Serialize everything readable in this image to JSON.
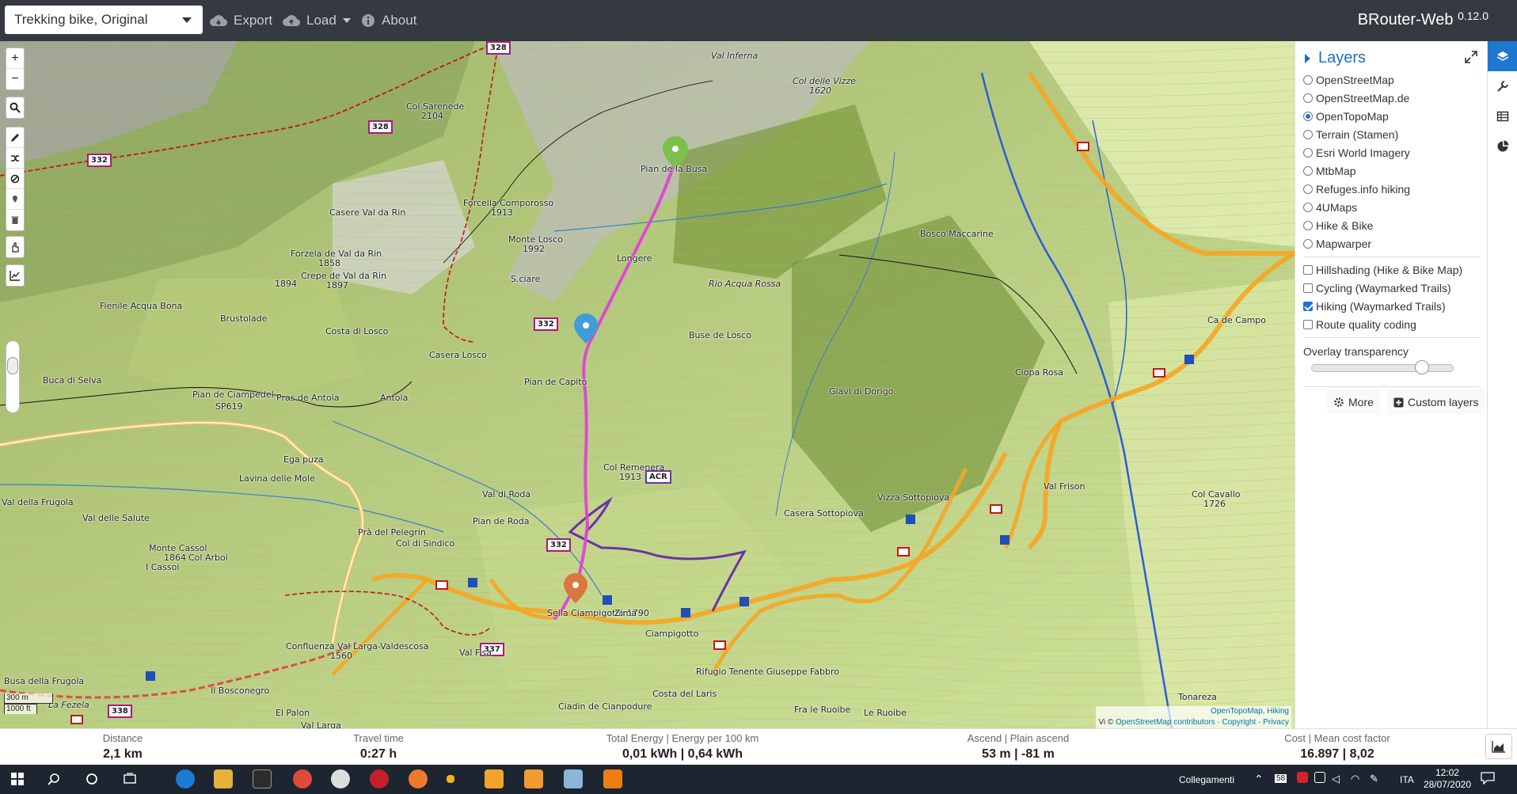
{
  "navbar": {
    "profile": "Trekking bike, Original",
    "export_label": "Export",
    "load_label": "Load",
    "about_label": "About",
    "brand": "BRouter-Web",
    "version": "0.12.0"
  },
  "map": {
    "labels": [
      {
        "text": "Val Inferna",
        "it": true
      },
      {
        "text": "Col delle Vizze",
        "it": true
      },
      {
        "text": "1620",
        "it": true
      },
      {
        "text": "Col Sarenede",
        "it": false
      },
      {
        "text": "2104",
        "it": false
      },
      {
        "text": "Pian de la Busa",
        "it": false
      },
      {
        "text": "Forcella Comporosso",
        "it": false
      },
      {
        "text": "1913",
        "it": false
      },
      {
        "text": "Casere Val da Rin",
        "it": false
      },
      {
        "text": "Monte Losco",
        "it": false
      },
      {
        "text": "1992",
        "it": false
      },
      {
        "text": "Forzela de Val da Rin",
        "it": false
      },
      {
        "text": "1858",
        "it": false
      },
      {
        "text": "Crepe de Val da Rin",
        "it": false
      },
      {
        "text": "1897",
        "it": false
      },
      {
        "text": "1894",
        "it": false
      },
      {
        "text": "Longere",
        "it": false
      },
      {
        "text": "Bosco Maccarine",
        "it": false
      },
      {
        "text": "S.ciare",
        "it": false
      },
      {
        "text": "Fienile Acqua Bona",
        "it": false
      },
      {
        "text": "Brustolade",
        "it": false
      },
      {
        "text": "Costa di Losco",
        "it": false
      },
      {
        "text": "Casera Losco",
        "it": false
      },
      {
        "text": "Buse de Losco",
        "it": false
      },
      {
        "text": "Rio Acqua Rossa",
        "it": true
      },
      {
        "text": "Buca di Selva",
        "it": false
      },
      {
        "text": "Pian de Ciampedel",
        "it": false
      },
      {
        "text": "Pras de Antoia",
        "it": false
      },
      {
        "text": "Antoia",
        "it": false
      },
      {
        "text": "Pian de Capito",
        "it": false
      },
      {
        "text": "Giavi di Dorigo",
        "it": false
      },
      {
        "text": "Ciopa Rosa",
        "it": false
      },
      {
        "text": "Ca de Campo",
        "it": false
      },
      {
        "text": "SP619",
        "it": false
      },
      {
        "text": "Ega puza",
        "it": false
      },
      {
        "text": "Col Remenera",
        "it": false
      },
      {
        "text": "1913",
        "it": false
      },
      {
        "text": "ACR",
        "it": false
      },
      {
        "text": "Lavina delle Mole",
        "it": false
      },
      {
        "text": "Val di Roda",
        "it": false
      },
      {
        "text": "Vizza Sottopiova",
        "it": false
      },
      {
        "text": "Val Frison",
        "it": false
      },
      {
        "text": "Col Cavallo",
        "it": false
      },
      {
        "text": "1726",
        "it": false
      },
      {
        "text": "Val della Frugola",
        "it": false
      },
      {
        "text": "Val delle Salute",
        "it": false
      },
      {
        "text": "Pian de Roda",
        "it": false
      },
      {
        "text": "Prà del Pelegrin",
        "it": false
      },
      {
        "text": "Col di Sindico",
        "it": false
      },
      {
        "text": "Casera Sottopiova",
        "it": false
      },
      {
        "text": "Sella Ciampigotto 1790",
        "it": false
      },
      {
        "text": "Zima",
        "it": false
      },
      {
        "text": "Monte Cassol",
        "it": false
      },
      {
        "text": "1864",
        "it": false
      },
      {
        "text": "Col Arboi",
        "it": false
      },
      {
        "text": "I Cassoi",
        "it": false
      },
      {
        "text": "Confluenza Val Larga-Valdescosa",
        "it": false
      },
      {
        "text": "1560",
        "it": false
      },
      {
        "text": "Ciampigotto",
        "it": false
      },
      {
        "text": "Rifugio Tenente Giuseppe Fabbro",
        "it": false
      },
      {
        "text": "Busa della Frugola",
        "it": false
      },
      {
        "text": "Il Bosconegro",
        "it": false
      },
      {
        "text": "Costa del Laris",
        "it": false
      },
      {
        "text": "El Palon",
        "it": false
      },
      {
        "text": "Ciadin de Cianpodure",
        "it": false
      },
      {
        "text": "Fra le Ruoibe",
        "it": false
      },
      {
        "text": "Le Ruoibe",
        "it": false
      },
      {
        "text": "Tonareza",
        "it": false
      },
      {
        "text": "Val Larga",
        "it": false
      },
      {
        "text": "La Fezela",
        "it": false
      },
      {
        "text": "Val Fisa",
        "it": false
      }
    ],
    "badges": [
      "332",
      "328",
      "328",
      "332",
      "332",
      "337",
      "338"
    ],
    "scale": {
      "metric": "300 m",
      "imperial": "1000 ft"
    },
    "attribution": {
      "line1": "OpenTopoMap, Hiking",
      "prefix": "© ",
      "osm": "OpenStreetMap contributors",
      "copyright": "Copyright",
      "privacy": "Privacy",
      "leaflet": "Vi"
    }
  },
  "controls": [
    "+",
    "−"
  ],
  "sidebar": {
    "title": "Layers",
    "base_layers": [
      {
        "label": "OpenStreetMap",
        "selected": false
      },
      {
        "label": "OpenStreetMap.de",
        "selected": false
      },
      {
        "label": "OpenTopoMap",
        "selected": true
      },
      {
        "label": "Terrain (Stamen)",
        "selected": false
      },
      {
        "label": "Esri World Imagery",
        "selected": false
      },
      {
        "label": "MtbMap",
        "selected": false
      },
      {
        "label": "Refuges.info hiking",
        "selected": false
      },
      {
        "label": "4UMaps",
        "selected": false
      },
      {
        "label": "Hike & Bike",
        "selected": false
      },
      {
        "label": "Mapwarper",
        "selected": false
      }
    ],
    "overlays": [
      {
        "label": "Hillshading (Hike & Bike Map)",
        "checked": false
      },
      {
        "label": "Cycling (Waymarked Trails)",
        "checked": false
      },
      {
        "label": "Hiking (Waymarked Trails)",
        "checked": true
      },
      {
        "label": "Route quality coding",
        "checked": false
      }
    ],
    "transparency_label": "Overlay transparency",
    "more_label": "More",
    "custom_label": "Custom layers"
  },
  "stats": [
    {
      "label": "Distance",
      "value": "2,1 km"
    },
    {
      "label": "Travel time",
      "value": "0:27 h"
    },
    {
      "label": "Total Energy | Energy per 100 km",
      "value": "0,01 kWh | 0,64 kWh"
    },
    {
      "label": "Ascend | Plain ascend",
      "value": "53 m | -81 m"
    },
    {
      "label": "Cost | Mean cost factor",
      "value": "16.897 | 8,02"
    }
  ],
  "taskbar": {
    "tray_label": "Collegamenti",
    "notification_count": "58",
    "lang": "ITA",
    "time": "12:02",
    "date": "28/07/2020"
  },
  "colors": {
    "navbar": "#343a40",
    "accent": "#1f77d0",
    "route": "#e042d6",
    "hiking": "#f5a623"
  }
}
